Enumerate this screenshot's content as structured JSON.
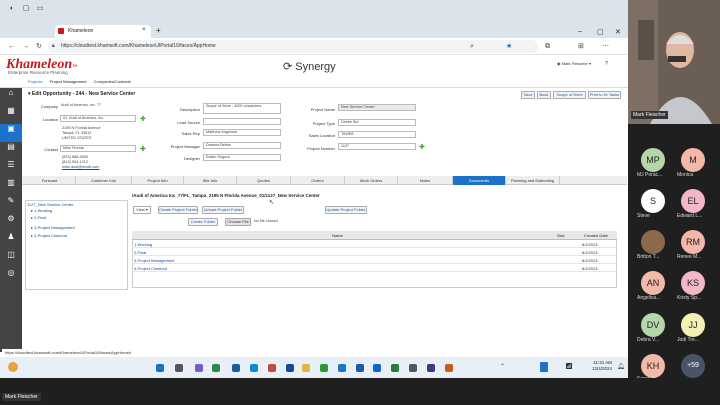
{
  "browser": {
    "tab_title": "Khameleon",
    "url": "https://cloudtest.khamsoft.com/KhameleonUIPortal10/faces/AppHome"
  },
  "app": {
    "logo": "Khameleon",
    "logo_tm": "™",
    "logo_sub": "Enterprise Resource Planning",
    "product": "Synergy",
    "user": "Mark Fleischer",
    "brand_color": "#c41a1a"
  },
  "nav": [
    "Projects",
    "Project Management",
    "Companies/Contacts"
  ],
  "form": {
    "title": "Edit Opportunity - 244 - New Service Center",
    "buttons": [
      "Save",
      "Back",
      "Scope of Work",
      "Print to Dr Tasks"
    ],
    "company_label": "Company",
    "company": "Audi of America, Inc. 77",
    "location_label": "Location",
    "location": "01. Audi of America, Inc.",
    "address": [
      "2195 N Florida Avenue",
      "Tampa, FL 33612",
      "UNITED STATES"
    ],
    "contact_label": "Contact",
    "contact": "Mike Florida",
    "phones": [
      "(813) 888-5555",
      "(813) 554-1212",
      "mike.audi@email.com"
    ],
    "description_label": "Description",
    "description": "Scope of Work - 4000 characters",
    "lead_label": "Lead Source",
    "sales_label": "Sales Rep",
    "sales": "Matthew Angelone",
    "pm_label": "Project Manager",
    "pm": "Deanna Belton",
    "designer_label": "Designer",
    "designer": "Edwin Segura",
    "pname_label": "Project Name",
    "pname": "New Service Center",
    "ptype_label": "Project Type",
    "ptype": "Desire Bid",
    "sloc_label": "Sales Location",
    "sloc": "TAMPA",
    "pnum_label": "Project Number",
    "pnum": "1127"
  },
  "tabs": [
    "Forecast",
    "Customer Info",
    "Project Info",
    "Site Info",
    "Quotes",
    "Orders",
    "Work Orders",
    "Notes",
    "Documents",
    "Planning and Estimating"
  ],
  "docs": {
    "tree": [
      "1127_New Service Center",
      "1-Working",
      "2-Final",
      "3-Project Management",
      "4-Project Closeout"
    ],
    "path": "/Audi of America Inc_77/FL_Tampa_2195 N Florida Avenue_01/1127_New Service Center",
    "view": "View",
    "create_folder_btn": "Create Project Folder",
    "upload_btn": "Upload Project Folder",
    "update_btn": "Update Project Folder",
    "create_btn": "Create Folder",
    "choose_file": "Choose File",
    "no_file": "No file chosen",
    "headers": [
      "Name",
      "Size",
      "Created Date"
    ],
    "rows": [
      {
        "name": "1-Working",
        "date": "8/1/2024"
      },
      {
        "name": "2-Final",
        "date": "8/1/2024"
      },
      {
        "name": "3-Project Management",
        "date": "8/1/2024"
      },
      {
        "name": "4-Project Closeout",
        "date": "8/1/2024"
      }
    ]
  },
  "status_url": "https://cloudtest.khamsoft.com/KhameleonUIPortal10/faces/AppHome#",
  "clock": {
    "time": "11:31 AM",
    "date": "12/4/2024"
  },
  "meeting": {
    "presenter": "Mark Fleischer",
    "count": "+59",
    "participants": [
      {
        "initials": "MP",
        "name": "MJ Porac...",
        "color": "#b5d6a7"
      },
      {
        "initials": "M",
        "name": "Monica",
        "color": "#f2b8a8"
      },
      {
        "initials": "S",
        "name": "Steve",
        "color": "#ffffff"
      },
      {
        "initials": "EL",
        "name": "Edward L...",
        "color": "#f2b8c6"
      },
      {
        "initials": "",
        "name": "Britton T...",
        "color": "#8a6a4a"
      },
      {
        "initials": "RM",
        "name": "Renee M...",
        "color": "#f2b8a8"
      },
      {
        "initials": "AN",
        "name": "Angelica...",
        "color": "#f2b8a8"
      },
      {
        "initials": "KS",
        "name": "Kristy Sp...",
        "color": "#f2b8c6"
      },
      {
        "initials": "DV",
        "name": "Debra V...",
        "color": "#b5d6a7"
      },
      {
        "initials": "JJ",
        "name": "Jodi Tre...",
        "color": "#f5f0b5"
      },
      {
        "initials": "KH",
        "name": "Karen H...",
        "color": "#f2b8a8"
      }
    ]
  }
}
